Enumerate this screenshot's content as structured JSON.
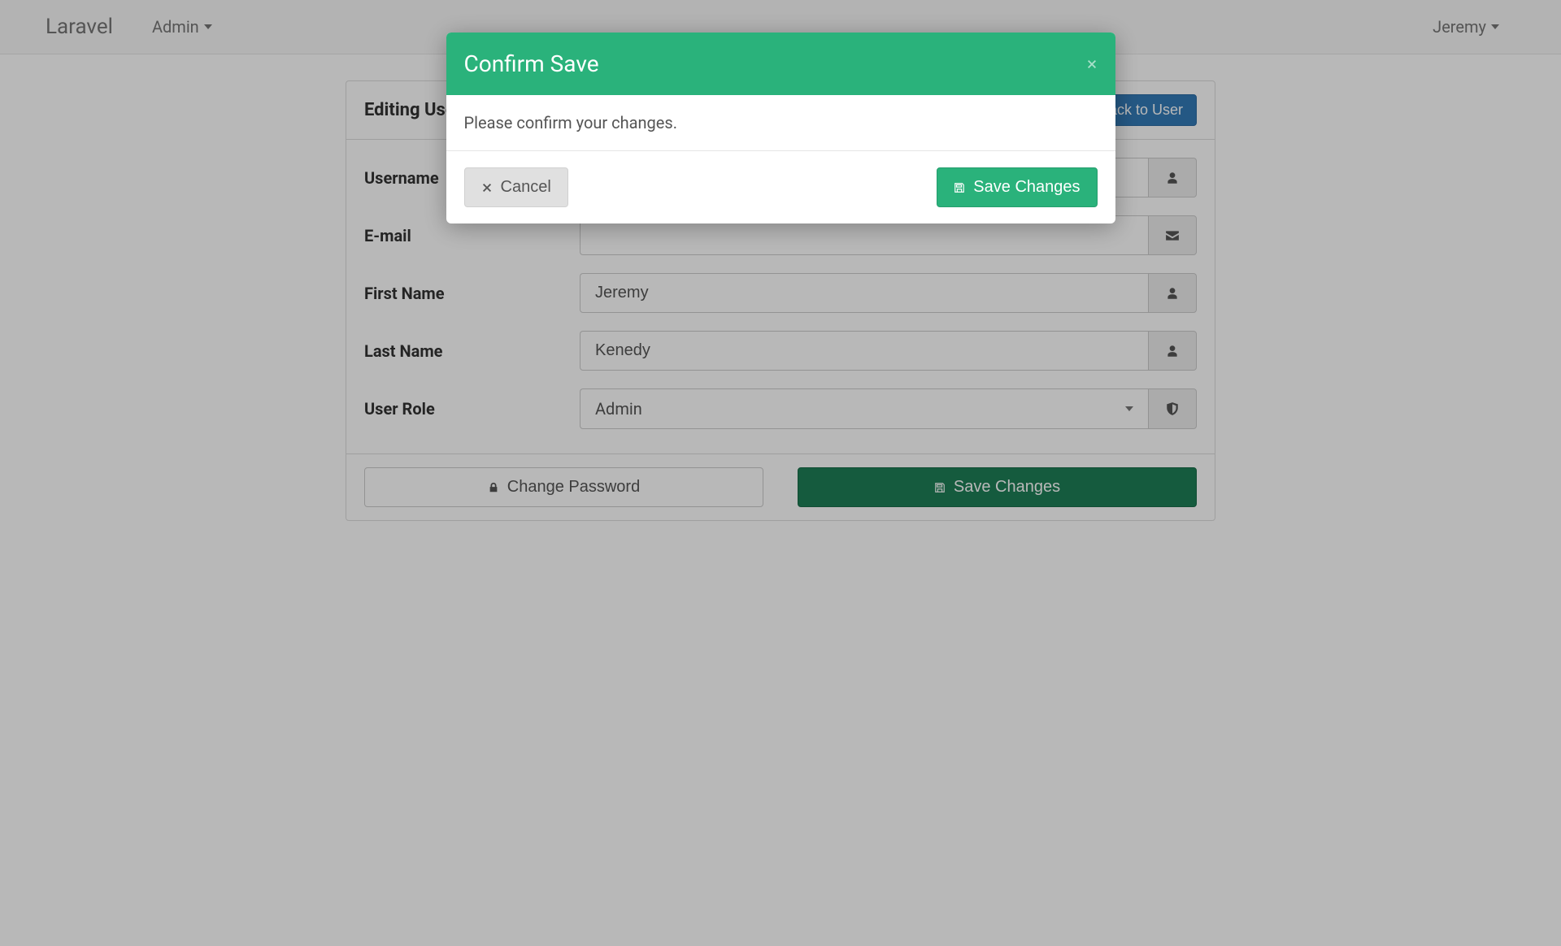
{
  "navbar": {
    "brand": "Laravel",
    "left_item": "Admin",
    "right_item": "Jeremy"
  },
  "panel": {
    "title": "Editing User",
    "back_button": "Back to User"
  },
  "form": {
    "username": {
      "label": "Username",
      "value": ""
    },
    "email": {
      "label": "E-mail",
      "value": ""
    },
    "first_name": {
      "label": "First Name",
      "value": "Jeremy"
    },
    "last_name": {
      "label": "Last Name",
      "value": "Kenedy"
    },
    "user_role": {
      "label": "User Role",
      "value": "Admin"
    }
  },
  "footer": {
    "change_password": "Change Password",
    "save_changes": "Save Changes"
  },
  "modal": {
    "title": "Confirm Save",
    "body": "Please confirm your changes.",
    "cancel": "Cancel",
    "save": "Save Changes"
  }
}
